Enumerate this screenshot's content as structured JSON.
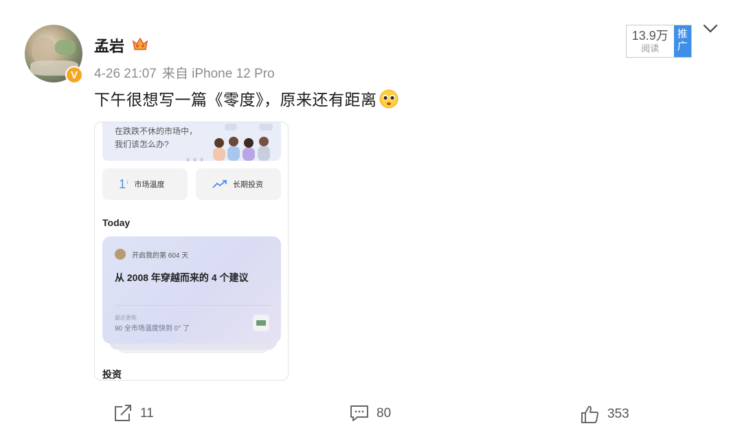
{
  "post": {
    "username": "孟岩",
    "timestamp": "4-26 21:07",
    "source": "来自 iPhone 12 Pro",
    "text": "下午很想写一篇《零度》，原来还有距离",
    "verified_badge": "V",
    "views_count": "13.9万",
    "views_label": "阅读",
    "promo_label": "推广"
  },
  "embedded_screenshot": {
    "banner_line1": "在跌跌不休的市场中，",
    "banner_line2": "我们该怎么办?",
    "tile1_label": "市场温度",
    "tile1_icon_text": "1",
    "tile2_label": "长期投资",
    "today_heading": "Today",
    "card_days": "开启我的第 604 天",
    "card_headline": "从 2008 年穿越而来的 4 个建议",
    "card_updated_label": "最近更新",
    "card_updated_text": "90 全市场温度快到 0° 了",
    "section_invest": "投资"
  },
  "actions": {
    "share_count": "11",
    "comment_count": "80",
    "like_count": "353"
  },
  "colors": {
    "accent_blue": "#3d8fe8",
    "verified_orange": "#f6a623",
    "meta_gray": "#8c8c8c"
  }
}
